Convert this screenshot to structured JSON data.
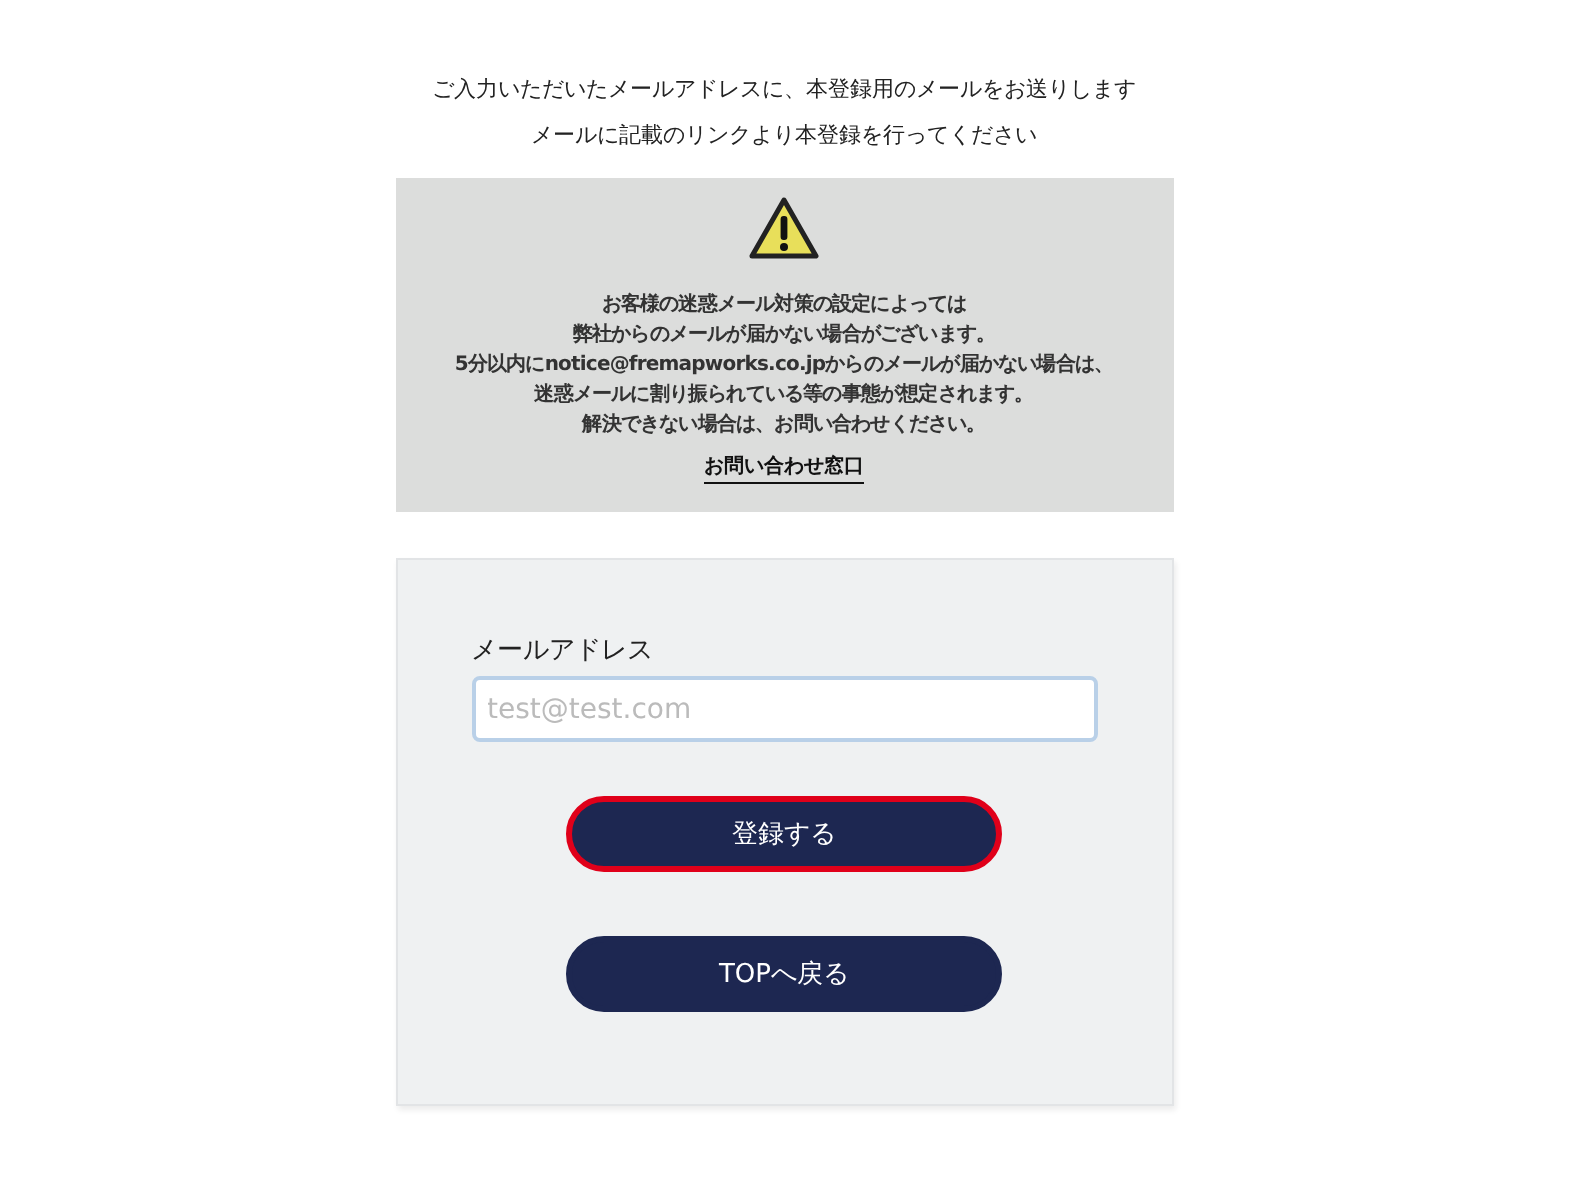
{
  "intro": [
    "ご入力いただいたメールアドレスに、本登録用のメールをお送りします",
    "メールに記載のリンクより本登録を行ってください"
  ],
  "notice": {
    "lines": [
      "お客様の迷惑メール対策の設定によっては",
      "弊社からのメールが届かない場合がございます。",
      "5分以内にnotice@fremapworks.co.jpからのメールが届かない場合は、",
      "迷惑メールに割り振られている等の事態が想定されます。",
      "解決できない場合は、お問い合わせください。"
    ],
    "link": "お問い合わせ窓口"
  },
  "form": {
    "field": {
      "label": "メールアドレス",
      "placeholder": "test@test.com",
      "focused": true
    },
    "buttons": [
      {
        "label": "登録する",
        "focused": true
      },
      {
        "label": "TOPへ戻る",
        "focused": false
      }
    ]
  }
}
